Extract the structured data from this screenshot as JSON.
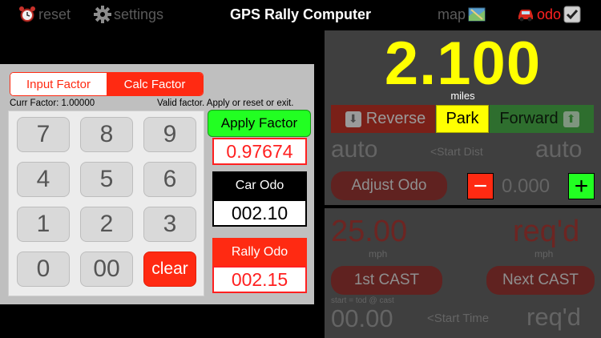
{
  "topbar": {
    "reset_label": "reset",
    "reset_icon": "alarm-clock-icon",
    "settings_label": "settings",
    "settings_icon": "gear-icon",
    "title": "GPS Rally Computer",
    "map_label": "map",
    "map_icon": "map-icon",
    "odo_label": "odo",
    "odo_icons": [
      "car-icon",
      "checkbox-checked-icon"
    ]
  },
  "factor_panel": {
    "tabs": [
      {
        "label": "Input Factor",
        "selected": false
      },
      {
        "label": "Calc Factor",
        "selected": true
      }
    ],
    "current_factor": "Curr Factor: 1.00000",
    "status": "Valid factor. Apply or reset or exit.",
    "keys": [
      "7",
      "8",
      "9",
      "4",
      "5",
      "6",
      "1",
      "2",
      "3",
      "0",
      "00"
    ],
    "clear_label": "clear",
    "apply_label": "Apply Factor",
    "calculated_factor": "0.97674",
    "car_odo_label": "Car Odo",
    "car_odo_value": "002.10",
    "rally_odo_label": "Rally Odo",
    "rally_odo_value": "002.15"
  },
  "odometer": {
    "distance": "2.100",
    "unit": "miles",
    "reverse_label": "Reverse",
    "park_label": "Park",
    "forward_label": "Forward",
    "auto_left": "auto",
    "start_dist_label": "<Start Dist",
    "auto_right": "auto",
    "adjust_label": "Adjust Odo",
    "minus_label": "−",
    "adjust_value": "0.000",
    "plus_label": "+"
  },
  "cast": {
    "speed": "25.00",
    "reqd_top": "req'd",
    "speed_unit": "mph",
    "reqd_unit": "mph",
    "first_cast_label": "1st CAST",
    "next_cast_label": "Next CAST",
    "start_note": "start = tod @ cast",
    "start_time": "00.00",
    "start_time_label": "<Start Time",
    "reqd_bottom": "req'd"
  },
  "colors": {
    "accent_red": "#ff2a12",
    "apply_green": "#22ff22",
    "distance_yellow": "#ffff00",
    "panel_gray": "#3f3f3f"
  }
}
